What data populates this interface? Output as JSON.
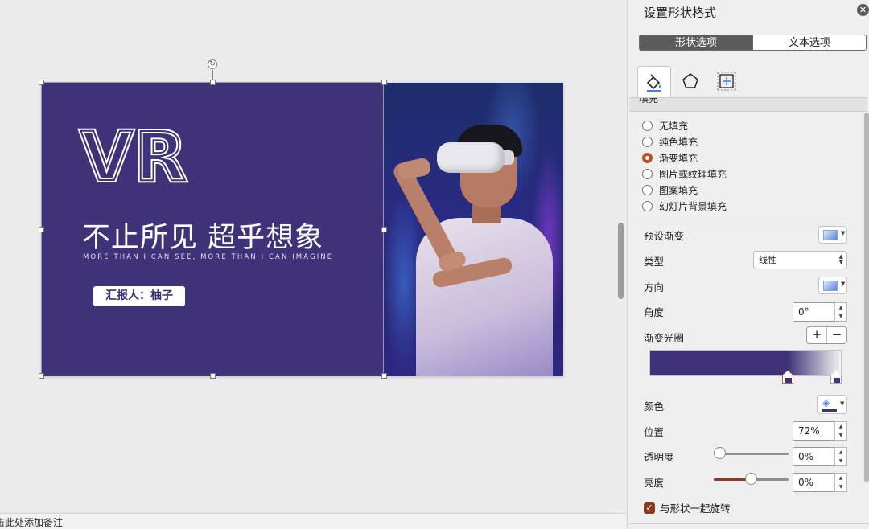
{
  "slide": {
    "title_big": "VR",
    "headline": "不止所见 超乎想象",
    "subline": "MORE THAN I CAN SEE, MORE THAN I CAN IMAGINE",
    "presenter": "汇报人：柚子",
    "bg_color": "#3f3278"
  },
  "notes_placeholder": "击此处添加备注",
  "panel": {
    "title": "设置形状格式",
    "tabs": [
      "形状选项",
      "文本选项"
    ],
    "active_tab": "形状选项",
    "icon_tabs": [
      "fill-line-icon",
      "shape-effects-icon",
      "size-properties-icon"
    ],
    "section": "填充",
    "fill_options": [
      "无填充",
      "纯色填充",
      "渐变填充",
      "图片或纹理填充",
      "图案填充",
      "幻灯片背景填充"
    ],
    "selected_fill": "渐变填充",
    "preset_label": "预设渐变",
    "type_label": "类型",
    "type_value": "线性",
    "direction_label": "方向",
    "angle_label": "角度",
    "angle_value": "0°",
    "stops_label": "渐变光圈",
    "add_stop": "+",
    "remove_stop": "−",
    "color_label": "颜色",
    "position_label": "位置",
    "position_value": "72%",
    "transparency_label": "透明度",
    "transparency_value": "0%",
    "brightness_label": "亮度",
    "brightness_value": "0%",
    "rotate_label": "与形状一起旋转",
    "rotate_checked": true,
    "gradient_stops": [
      0.72,
      1.0
    ],
    "selected_stop": 0,
    "transparency_level": 0,
    "brightness_level": 0,
    "accent": "#b5532a"
  }
}
